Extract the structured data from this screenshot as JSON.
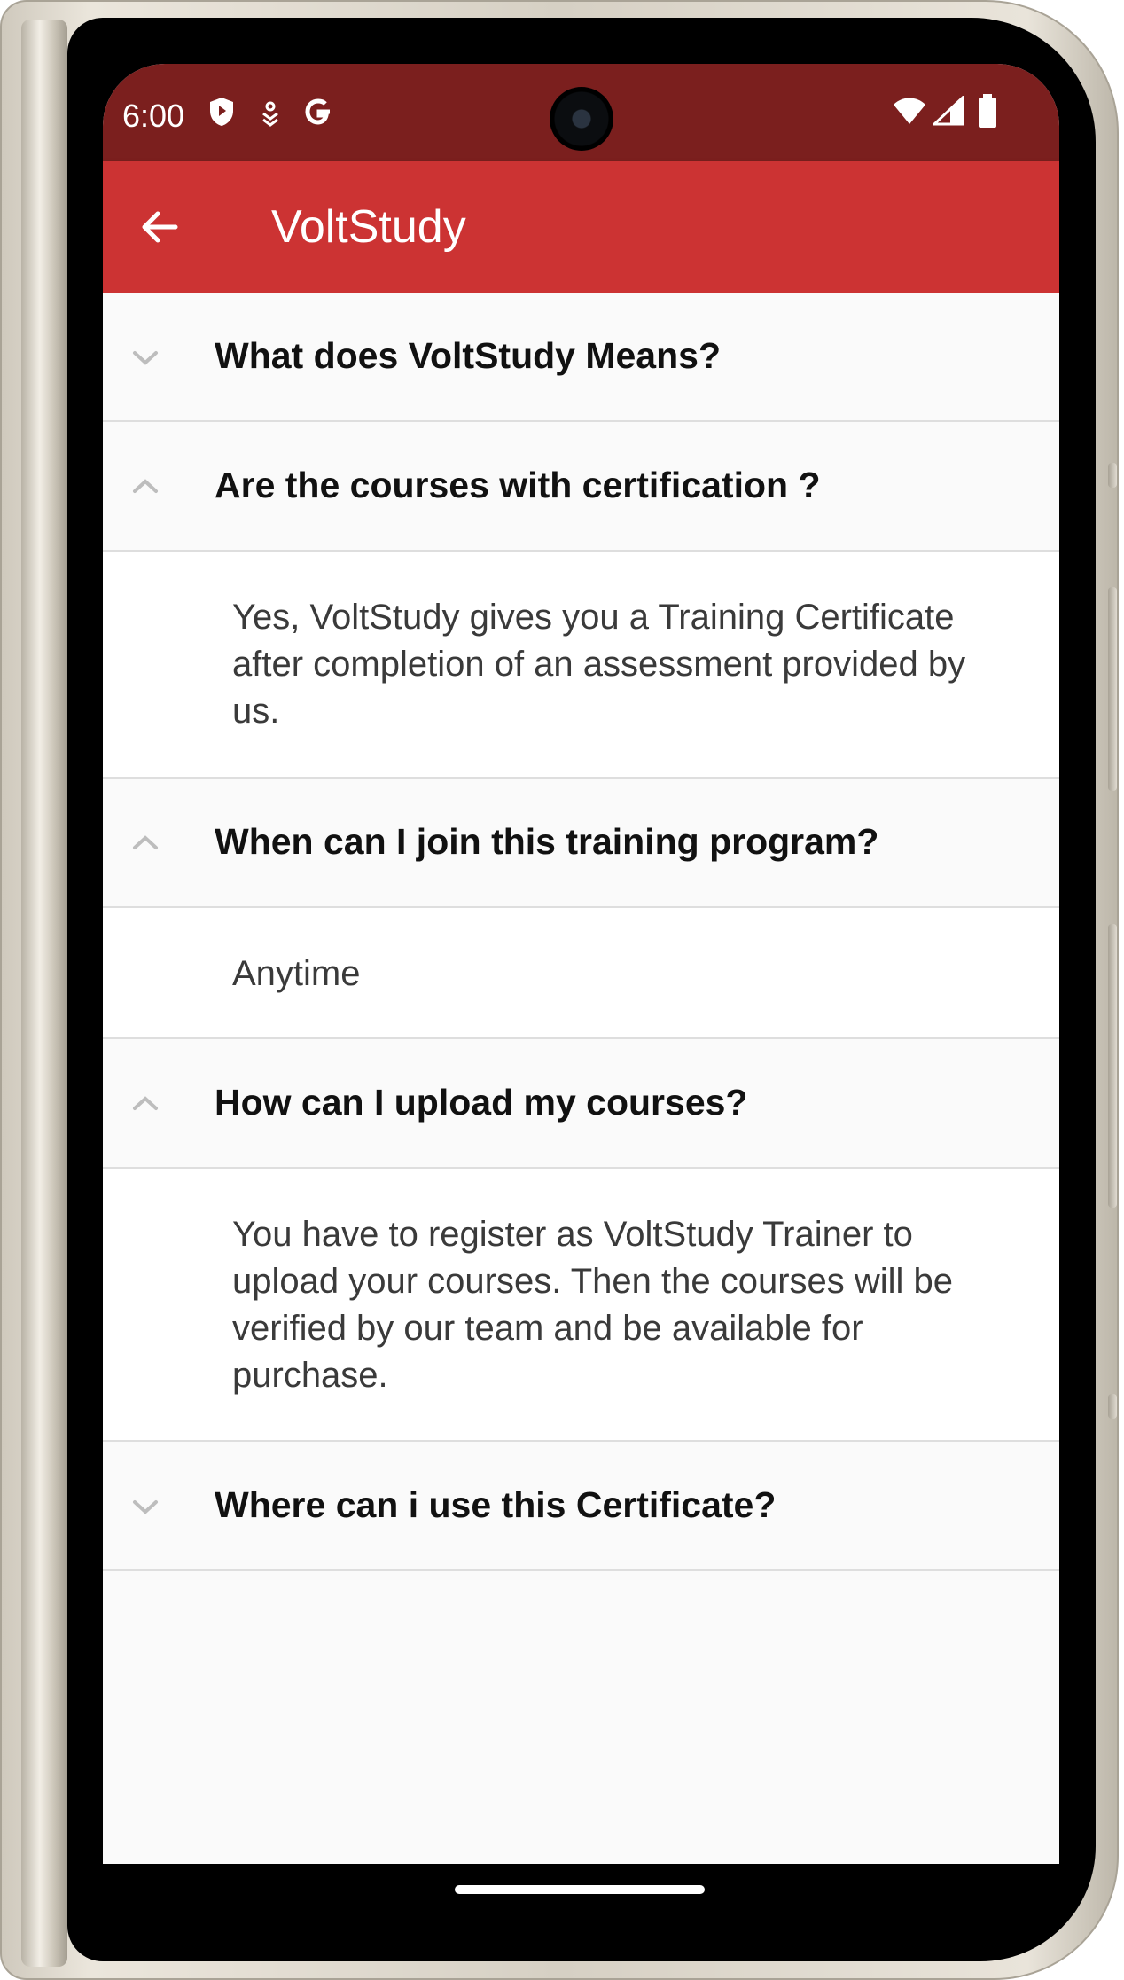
{
  "status_bar": {
    "time": "6:00",
    "left_icons": [
      "shield-icon",
      "location-pin-icon",
      "google-g-icon"
    ],
    "right_icons": [
      "wifi-icon",
      "cellular-signal-icon",
      "battery-icon"
    ]
  },
  "app_bar": {
    "title": "VoltStudy",
    "back_icon": "arrow-left-icon",
    "color": "#cc3333",
    "status_color": "#7b1f1e"
  },
  "faq": [
    {
      "question": "What does VoltStudy Means?",
      "expanded": false,
      "answer": ""
    },
    {
      "question": "Are the courses with certification ?",
      "expanded": true,
      "answer": "Yes, VoltStudy gives you a Training Certificate after completion of an assessment provided by us."
    },
    {
      "question": "When can I join this training program?",
      "expanded": true,
      "answer": "Anytime"
    },
    {
      "question": "How can I upload my courses?",
      "expanded": true,
      "answer": "You have to register as VoltStudy Trainer to upload your courses. Then the courses will be verified by our team and be available for purchase."
    },
    {
      "question": "Where can i use this Certificate?",
      "expanded": false,
      "answer": ""
    }
  ]
}
